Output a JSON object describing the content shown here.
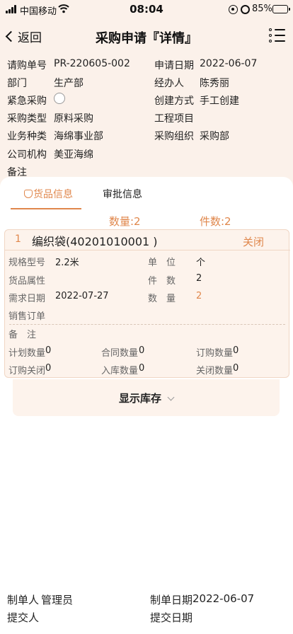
{
  "status_bar": {
    "carrier": "中国移动",
    "time": "08:04",
    "battery": "85%",
    "battery_level": 0.85
  },
  "nav": {
    "back_label": "返回",
    "title": "采购申请『详情』"
  },
  "header": {
    "order_no_label": "请购单号",
    "order_no": "PR-220605-002",
    "apply_date_label": "申请日期",
    "apply_date": "2022-06-07",
    "dept_label": "部门",
    "dept": "生产部",
    "handler_label": "经办人",
    "handler": "陈秀丽",
    "urgent_label": "紧急采购",
    "create_method_label": "创建方式",
    "create_method": "手工创建",
    "purchase_type_label": "采购类型",
    "purchase_type": "原料采购",
    "project_label": "工程项目",
    "project": "",
    "biz_type_label": "业务种类",
    "biz_type": "海绵事业部",
    "purchase_org_label": "采购组织",
    "purchase_org": "采购部",
    "company_label": "公司机构",
    "company": "美亚海绵",
    "remark_label": "备注",
    "remark": ""
  },
  "tabs": {
    "goods": "货品信息",
    "approval": "审批信息"
  },
  "summary": {
    "qty": "数量:2",
    "pieces": "件数:2"
  },
  "item": {
    "index": "1",
    "name": "编织袋(40201010001 )",
    "status": "关闭",
    "spec_label": "规格型号",
    "spec": "2.2米",
    "unit_label": "单　位",
    "unit": "个",
    "attr_label": "货品属性",
    "attr": "",
    "pieces_label": "件　数",
    "pieces": "2",
    "demand_date_label": "需求日期",
    "demand_date": "2022-07-27",
    "qty_label": "数　量",
    "qty": "2",
    "sales_order_label": "销售订单",
    "sales_order": "",
    "remark_label": "备　注",
    "remark": "",
    "plan_qty_label": "计划数量",
    "plan_qty": "0",
    "contract_qty_label": "合同数量",
    "contract_qty": "0",
    "order_qty_label": "订购数量",
    "order_qty": "0",
    "order_closed_label": "订购关闭",
    "order_closed": "0",
    "stock_in_qty_label": "入库数量",
    "stock_in_qty": "0",
    "closed_qty_label": "关闭数量",
    "closed_qty": "0"
  },
  "stock": {
    "label": "显示库存"
  },
  "footer": {
    "creator_label": "制单人",
    "creator": "管理员",
    "create_date_label": "制单日期",
    "create_date": "2022-06-07",
    "submitter_label": "提交人",
    "submitter": "",
    "submit_date_label": "提交日期",
    "submit_date": ""
  },
  "colors": {
    "accent": "#e0874c",
    "header_bg": "#fbf1ea",
    "battery_green": "#3cc43c"
  }
}
